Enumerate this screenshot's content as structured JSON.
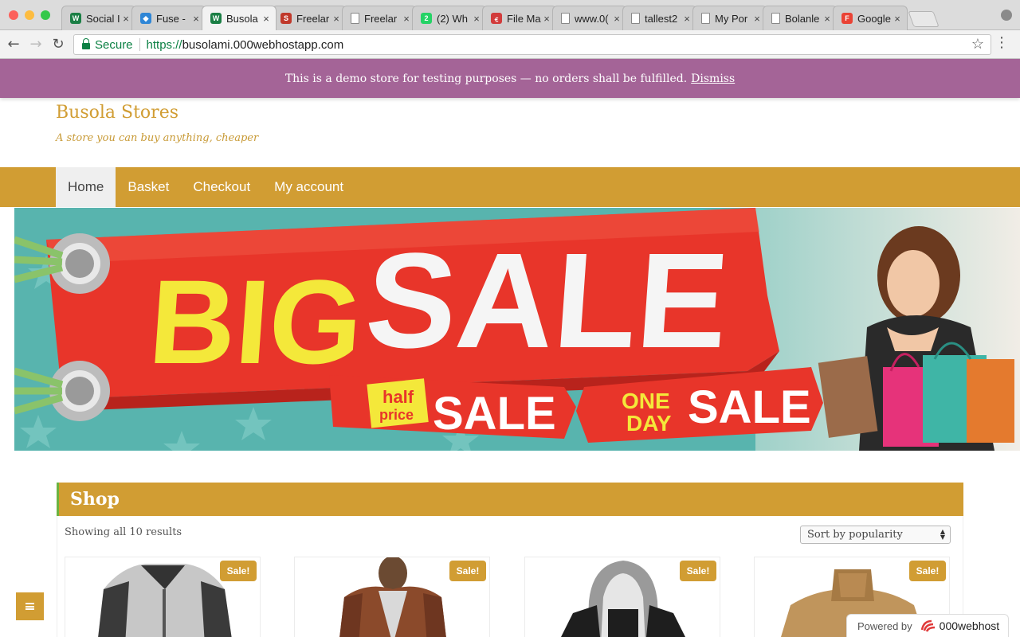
{
  "browser": {
    "tabs": [
      {
        "title": "Social I",
        "icon": "woocommerce-icon",
        "color": "#1b7f45",
        "glyph": "W",
        "active": false
      },
      {
        "title": "Fuse -",
        "icon": "diamond-icon",
        "color": "#2f86d6",
        "glyph": "◆",
        "active": false
      },
      {
        "title": "Busola",
        "icon": "woocommerce-icon",
        "color": "#1b7f45",
        "glyph": "W",
        "active": true
      },
      {
        "title": "Freelar",
        "icon": "s-logo-icon",
        "color": "#c0392b",
        "glyph": "S",
        "active": false
      },
      {
        "title": "Freelar",
        "icon": "page-icon",
        "color": "#888888",
        "glyph": "",
        "active": false
      },
      {
        "title": "(2) Wh",
        "icon": "whatsapp-icon",
        "color": "#25d366",
        "glyph": "2",
        "active": false
      },
      {
        "title": "File Ma",
        "icon": "000webhost-icon",
        "color": "#d23c3c",
        "glyph": "ꞓ",
        "active": false
      },
      {
        "title": "www.0(",
        "icon": "page-icon",
        "color": "#888888",
        "glyph": "",
        "active": false
      },
      {
        "title": "tallest2",
        "icon": "page-icon",
        "color": "#888888",
        "glyph": "",
        "active": false
      },
      {
        "title": "My Por",
        "icon": "page-icon",
        "color": "#888888",
        "glyph": "",
        "active": false
      },
      {
        "title": "Bolanle",
        "icon": "page-icon",
        "color": "#888888",
        "glyph": "",
        "active": false
      },
      {
        "title": "Google",
        "icon": "f-logo-icon",
        "color": "#ea4335",
        "glyph": "F",
        "active": false
      }
    ],
    "secure_label": "Secure",
    "url_scheme": "https://",
    "url_host": "busolami.000webhostapp.com"
  },
  "notice": {
    "text": "This is a demo store for testing purposes — no orders shall be fulfilled.",
    "dismiss": "Dismiss",
    "color": "#a46497"
  },
  "site": {
    "title": "Busola Stores",
    "description": "A store you can buy anything, cheaper",
    "accent": "#d19d33"
  },
  "nav": {
    "items": [
      "Home",
      "Basket",
      "Checkout",
      "My account"
    ],
    "current": "Home"
  },
  "banner": {
    "big": "BIG",
    "sale": "SALE",
    "half": "half",
    "price": "price",
    "sale2": "SALE",
    "one": "ONE",
    "day": "DAY",
    "sale3": "SALE"
  },
  "shop": {
    "title": "Shop",
    "result_count": "Showing all 10 results",
    "sort_selected": "Sort by popularity",
    "products": [
      {
        "badge": "Sale!",
        "image": "motorcycle-jacket"
      },
      {
        "badge": "Sale!",
        "image": "brown-leather-jacket"
      },
      {
        "badge": "Sale!",
        "image": "hooded-jacket"
      },
      {
        "badge": "Sale!",
        "image": "tan-jacket"
      }
    ]
  },
  "footer": {
    "powered_by": "Powered by",
    "brand": "000webhost"
  }
}
